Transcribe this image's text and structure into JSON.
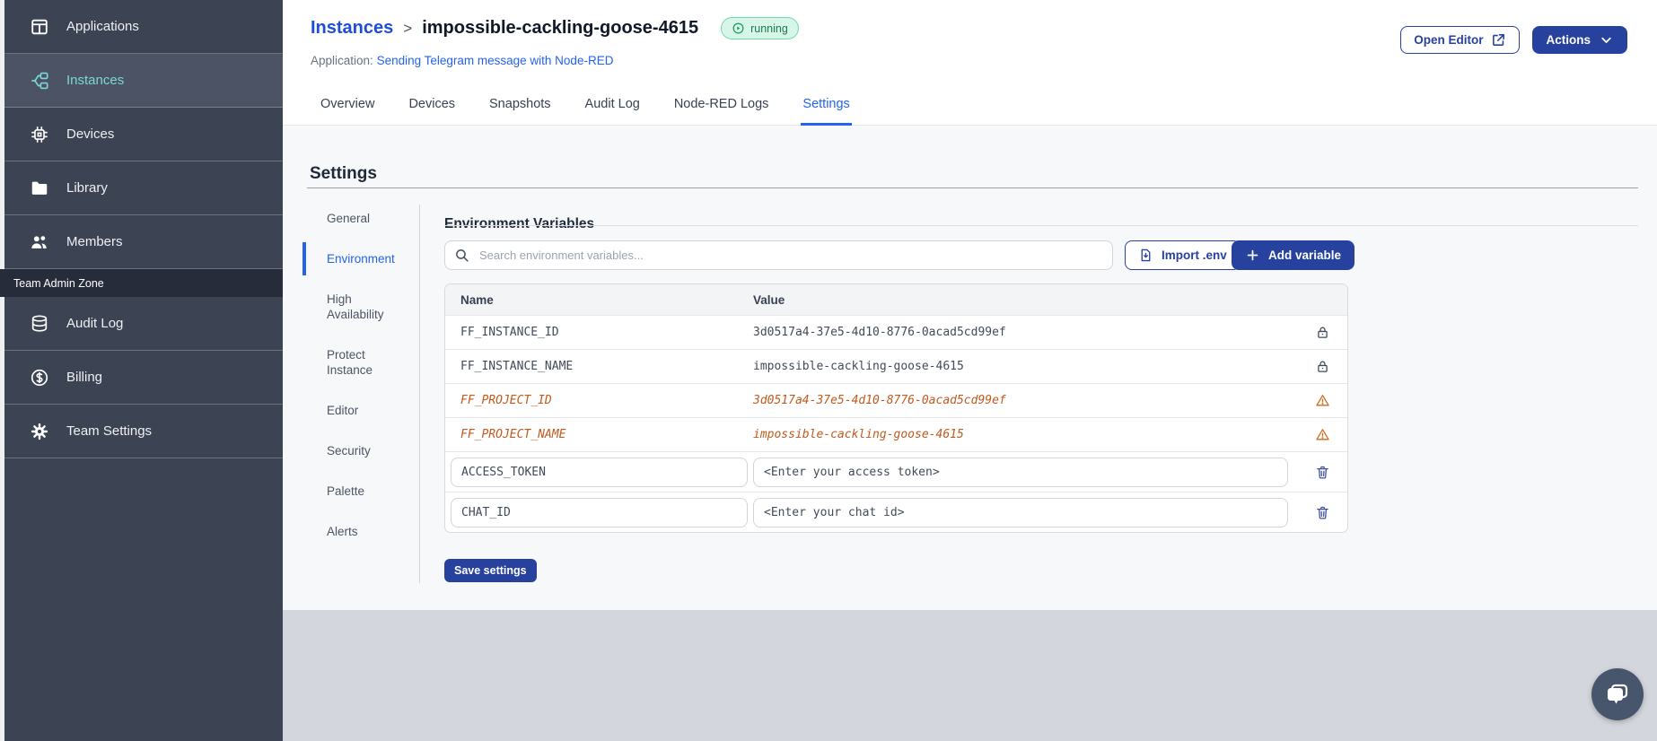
{
  "colors": {
    "accent_blue": "#27419e",
    "link_blue": "#2563eb",
    "breadcrumb_blue": "#1d4ed8",
    "sidebar_bg": "#3c4353",
    "sidebar_active_teal": "#7cd7d5",
    "warning_orange": "#c05a1f",
    "status_green": "#1b7a4e",
    "footer_gray": "#d3d6dc"
  },
  "sidebar": {
    "items": [
      {
        "label": "Applications"
      },
      {
        "label": "Instances"
      },
      {
        "label": "Devices"
      },
      {
        "label": "Library"
      },
      {
        "label": "Members"
      }
    ],
    "admin_zone_label": "Team Admin Zone",
    "admin_items": [
      {
        "label": "Audit Log"
      },
      {
        "label": "Billing"
      },
      {
        "label": "Team Settings"
      }
    ]
  },
  "header": {
    "breadcrumb": {
      "parent": "Instances",
      "separator": ">",
      "current": "impossible-cackling-goose-4615"
    },
    "status_badge": "running",
    "application_label": "Application:",
    "application_link": "Sending Telegram message with Node-RED",
    "open_editor_button": "Open Editor",
    "actions_button": "Actions"
  },
  "tabs": [
    {
      "label": "Overview"
    },
    {
      "label": "Devices"
    },
    {
      "label": "Snapshots"
    },
    {
      "label": "Audit Log"
    },
    {
      "label": "Node-RED Logs"
    },
    {
      "label": "Settings"
    }
  ],
  "settings": {
    "title": "Settings",
    "nav": [
      {
        "label": "General"
      },
      {
        "label": "Environment"
      },
      {
        "label": "High Availability"
      },
      {
        "label": "Protect Instance"
      },
      {
        "label": "Editor"
      },
      {
        "label": "Security"
      },
      {
        "label": "Palette"
      },
      {
        "label": "Alerts"
      }
    ],
    "panel": {
      "title": "Environment Variables",
      "search_placeholder": "Search environment variables...",
      "import_button": "Import .env",
      "add_button": "Add variable",
      "save_button": "Save settings"
    }
  },
  "env_table": {
    "columns": [
      "Name",
      "Value"
    ],
    "rows": [
      {
        "name": "FF_INSTANCE_ID",
        "value": "3d0517a4-37e5-4d10-8776-0acad5cd99ef",
        "type": "locked"
      },
      {
        "name": "FF_INSTANCE_NAME",
        "value": "impossible-cackling-goose-4615",
        "type": "locked"
      },
      {
        "name": "FF_PROJECT_ID",
        "value": "3d0517a4-37e5-4d10-8776-0acad5cd99ef",
        "type": "deprecated"
      },
      {
        "name": "FF_PROJECT_NAME",
        "value": "impossible-cackling-goose-4615",
        "type": "deprecated"
      },
      {
        "name": "ACCESS_TOKEN",
        "value": "<Enter your access token>",
        "type": "editable"
      },
      {
        "name": "CHAT_ID",
        "value": "<Enter your chat id>",
        "type": "editable"
      }
    ]
  }
}
